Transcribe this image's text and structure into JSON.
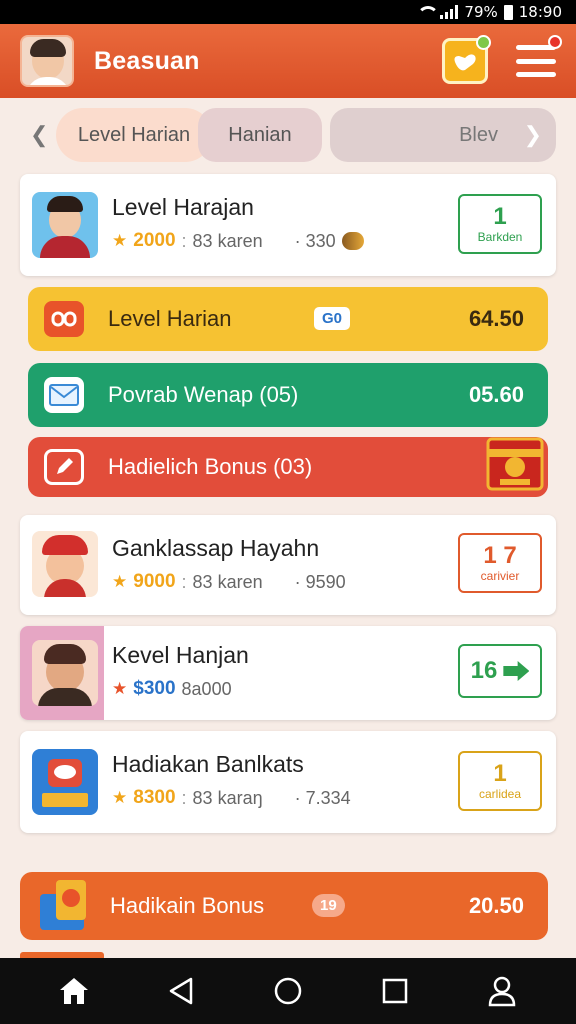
{
  "status_bar": {
    "battery": "79%",
    "time": "18:90"
  },
  "header": {
    "title": "Beasuan"
  },
  "tabs": [
    {
      "label": "Level Harian"
    },
    {
      "label": "Hanian"
    },
    {
      "label": "Blev"
    }
  ],
  "cards": [
    {
      "name": "Level Harajan",
      "points": "2000",
      "separator": ":",
      "sub": "83 karen",
      "score": "· 330",
      "badge_big": "1",
      "badge_small": "Barkden",
      "badge_color": "#2ea04f"
    },
    {
      "name": "Ganklassap Hayahn",
      "points": "9000",
      "separator": ":",
      "sub": "83 karen",
      "score": "· 9590",
      "badge_big": "1 7",
      "badge_small": "carivier",
      "badge_color": "#e05a2c"
    },
    {
      "name": "Kevel Hanjan",
      "points": "$300",
      "separator": "",
      "sub": "8a000",
      "score": "",
      "badge_big": "16",
      "badge_small": "",
      "badge_color": "#2ea04f"
    },
    {
      "name": "Hadiakan Banlkats",
      "points": "8300",
      "separator": ":",
      "sub": "83 karaŋ",
      "score": "· 7.334",
      "badge_big": "1",
      "badge_small": "carlidea",
      "badge_color": "#d9a319"
    }
  ],
  "bars": [
    {
      "label": "Level Harian",
      "chip": "G0",
      "value": "64.50",
      "color": "#f6c232"
    },
    {
      "label": "Povrab Wenap (05)",
      "chip": "",
      "value": "05.60",
      "color": "#1fa06c"
    },
    {
      "label": "Hadielich Bonus (03)",
      "chip": "",
      "value": "",
      "color": "#e24d3a"
    },
    {
      "label": "Hadikain Bonus",
      "chip": "19",
      "value": "20.50",
      "color": "#e9672a"
    }
  ],
  "colors": {
    "header": "#e45c30",
    "accent_orange": "#e9672a",
    "background": "#f7ece6"
  },
  "nav": [
    {
      "icon": "home-icon"
    },
    {
      "icon": "back-icon"
    },
    {
      "icon": "circle-home-icon"
    },
    {
      "icon": "recents-icon"
    },
    {
      "icon": "profile-icon"
    }
  ]
}
